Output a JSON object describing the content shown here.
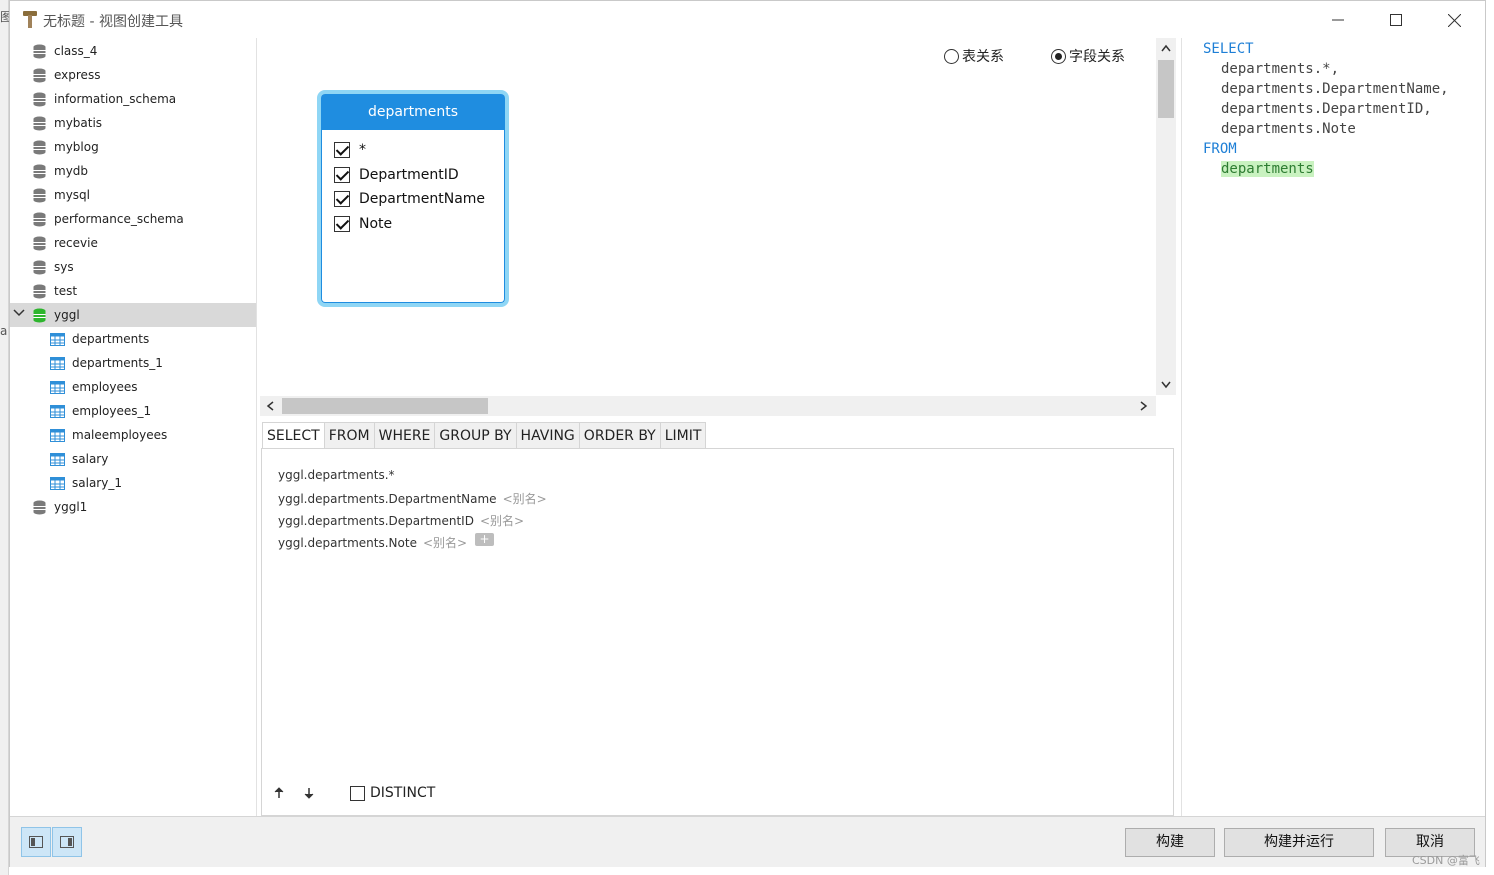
{
  "window": {
    "title": "无标题 - 视图创建工具"
  },
  "tree": {
    "databases": [
      {
        "label": "class_4"
      },
      {
        "label": "express"
      },
      {
        "label": "information_schema"
      },
      {
        "label": "mybatis"
      },
      {
        "label": "myblog"
      },
      {
        "label": "mydb"
      },
      {
        "label": "mysql"
      },
      {
        "label": "performance_schema"
      },
      {
        "label": "recevie"
      },
      {
        "label": "sys"
      },
      {
        "label": "test"
      },
      {
        "label": "yggl"
      }
    ],
    "tables": [
      {
        "label": "departments"
      },
      {
        "label": "departments_1"
      },
      {
        "label": "employees"
      },
      {
        "label": "employees_1"
      },
      {
        "label": "maleemployees"
      },
      {
        "label": "salary"
      },
      {
        "label": "salary_1"
      }
    ],
    "last_db": {
      "label": "yggl1"
    }
  },
  "design": {
    "mode_table": "表关系",
    "mode_field": "字段关系",
    "selected_mode": "字段关系",
    "table_card": {
      "name": "departments",
      "fields": [
        "*",
        "DepartmentID",
        "DepartmentName",
        "Note"
      ]
    }
  },
  "query_tabs": [
    "SELECT",
    "FROM",
    "WHERE",
    "GROUP BY",
    "HAVING",
    "ORDER BY",
    "LIMIT"
  ],
  "select_items": [
    {
      "expr": "yggl.departments.*",
      "alias": ""
    },
    {
      "expr": "yggl.departments.DepartmentName",
      "alias": "<别名>"
    },
    {
      "expr": "yggl.departments.DepartmentID",
      "alias": "<别名>"
    },
    {
      "expr": "yggl.departments.Note",
      "alias": "<别名>"
    }
  ],
  "add_symbol": "+",
  "distinct_label": "DISTINCT",
  "sql": {
    "select_kw": "SELECT",
    "col1": "departments.*,",
    "col2": "departments.DepartmentName,",
    "col3": "departments.DepartmentID,",
    "col4": "departments.Note",
    "from_kw": "FROM",
    "table": "departments"
  },
  "buttons": {
    "build": "构建",
    "build_run": "构建并运行",
    "cancel": "取消"
  },
  "watermark": "CSDN @富飞",
  "colors": {
    "accent": "#1f8de0",
    "card_glow": "#8fd6f5",
    "sql_keyword": "#1e7fd6",
    "sql_highlight": "#c9f2c0",
    "db_active": "#2db52d"
  }
}
